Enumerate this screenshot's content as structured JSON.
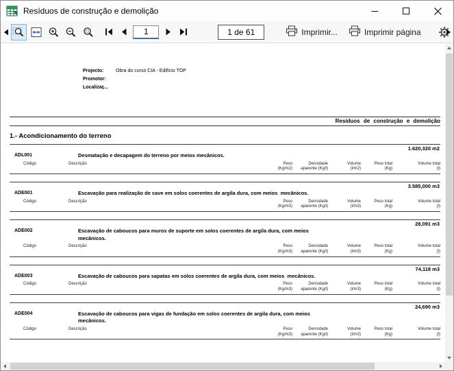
{
  "window": {
    "title": "Resíduos de construção e demolição"
  },
  "toolbar": {
    "page_input_value": "1",
    "page_indicator": "1 de 61",
    "print_button": "Imprimir...",
    "print_page_button": "Imprimir página"
  },
  "document": {
    "header": {
      "project_label": "Projecto:",
      "project_value": "Obra do curso CIA - Edifício TOP",
      "promoter_label": "Promotor:",
      "location_label": "Localizaç..."
    },
    "report_title": "Resíduos de construção e demolição",
    "section_title": "1.- Acondicionamento do terreno",
    "items": [
      {
        "code": "ADL001",
        "description": "Desmatação e decapagem do terreno por meios mecânicos.",
        "quantity": "1.620,320 m2",
        "columns": [
          {
            "l1": "Código",
            "l2": ""
          },
          {
            "l1": "Descrição",
            "l2": ""
          },
          {
            "l1": "Peso",
            "l2": "(Kg/m2)"
          },
          {
            "l1": "Densidade",
            "l2": "aparente (Kg/l)"
          },
          {
            "l1": "Volume",
            "l2": "(l/m2)"
          },
          {
            "l1": "Peso  total",
            "l2": "(Kg)"
          },
          {
            "l1": "Volume  total",
            "l2": "(l)"
          }
        ]
      },
      {
        "code": "ADE001",
        "description": "Escavação para realização de cave em solos coerentes de argila dura, com meios  mecânicos.",
        "quantity": "3.585,000 m3",
        "columns": [
          {
            "l1": "Código",
            "l2": ""
          },
          {
            "l1": "Descrição",
            "l2": ""
          },
          {
            "l1": "Peso",
            "l2": "(Kg/m3)"
          },
          {
            "l1": "Densidade",
            "l2": "aparente (Kg/l)"
          },
          {
            "l1": "Volume",
            "l2": "(l/m3)"
          },
          {
            "l1": "Peso  total",
            "l2": "(Kg)"
          },
          {
            "l1": "Volume  total",
            "l2": "(l)"
          }
        ]
      },
      {
        "code": "ADE002",
        "description": "Escavação de caboucos para muros de suporte em solos coerentes de argila dura, com meios mecânicos.",
        "quantity": "28,091 m3",
        "columns": [
          {
            "l1": "Código",
            "l2": ""
          },
          {
            "l1": "Descrição",
            "l2": ""
          },
          {
            "l1": "Peso",
            "l2": "(Kg/m3)"
          },
          {
            "l1": "Densidade",
            "l2": "aparente (Kg/l)"
          },
          {
            "l1": "Volume",
            "l2": "(l/m3)"
          },
          {
            "l1": "Peso  total",
            "l2": "(Kg)"
          },
          {
            "l1": "Volume  total",
            "l2": "(l)"
          }
        ]
      },
      {
        "code": "ADE003",
        "description": "Escavação de caboucos para sapatas em solos coerentes de argila dura, com meios  mecânicos.",
        "quantity": "74,118 m3",
        "columns": [
          {
            "l1": "Código",
            "l2": ""
          },
          {
            "l1": "Descrição",
            "l2": ""
          },
          {
            "l1": "Peso",
            "l2": "(Kg/m3)"
          },
          {
            "l1": "Densidade",
            "l2": "aparente (Kg/l)"
          },
          {
            "l1": "Volume",
            "l2": "(l/m3)"
          },
          {
            "l1": "Peso  total",
            "l2": "(Kg)"
          },
          {
            "l1": "Volume  total",
            "l2": "(l)"
          }
        ]
      },
      {
        "code": "ADE004",
        "description": "Escavação de caboucos para vigas de fundação em solos coerentes de argila dura, com meios mecânicos.",
        "quantity": "24,690 m3",
        "columns": [
          {
            "l1": "Código",
            "l2": ""
          },
          {
            "l1": "Descrição",
            "l2": ""
          },
          {
            "l1": "Peso",
            "l2": "(Kg/m3)"
          },
          {
            "l1": "Densidade",
            "l2": "aparente (Kg/l)"
          },
          {
            "l1": "Volume",
            "l2": "(l/m3)"
          },
          {
            "l1": "Peso  total",
            "l2": "(Kg)"
          },
          {
            "l1": "Volume  total",
            "l2": "(l)"
          }
        ]
      }
    ]
  }
}
